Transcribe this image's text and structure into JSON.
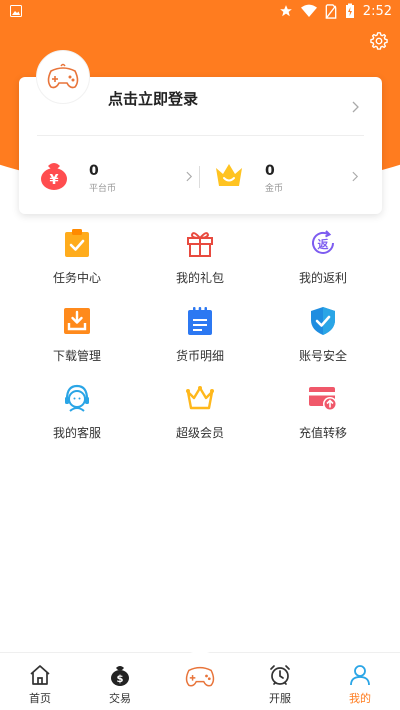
{
  "status_bar": {
    "time": "2:52"
  },
  "profile": {
    "login_label": "点击立即登录"
  },
  "stats": [
    {
      "value": "0",
      "label": "平台币",
      "icon": "money-bag-icon",
      "color": "#ff4d4f"
    },
    {
      "value": "0",
      "label": "金币",
      "icon": "crown-icon",
      "color": "#ffc321"
    }
  ],
  "menu": [
    {
      "label": "任务中心",
      "icon": "task-clipboard-icon"
    },
    {
      "label": "我的礼包",
      "icon": "gift-icon"
    },
    {
      "label": "我的返利",
      "icon": "rebate-icon"
    },
    {
      "label": "下载管理",
      "icon": "download-tray-icon"
    },
    {
      "label": "货币明细",
      "icon": "notepad-icon"
    },
    {
      "label": "账号安全",
      "icon": "shield-icon"
    },
    {
      "label": "我的客服",
      "icon": "headset-agent-icon"
    },
    {
      "label": "超级会员",
      "icon": "crown-icon"
    },
    {
      "label": "充值转移",
      "icon": "card-transfer-icon"
    }
  ],
  "nav": {
    "tabs": [
      {
        "label": "首页",
        "icon": "home-icon"
      },
      {
        "label": "交易",
        "icon": "money-bag-icon"
      },
      {
        "label": "开服",
        "icon": "alarm-clock-icon"
      },
      {
        "label": "我的",
        "icon": "person-icon"
      }
    ],
    "active_tab": "我的"
  },
  "colors": {
    "accent": "#ff7c1f",
    "active_tab": "#ff7c1f",
    "nav_icon_active": "#2aa5e6"
  }
}
